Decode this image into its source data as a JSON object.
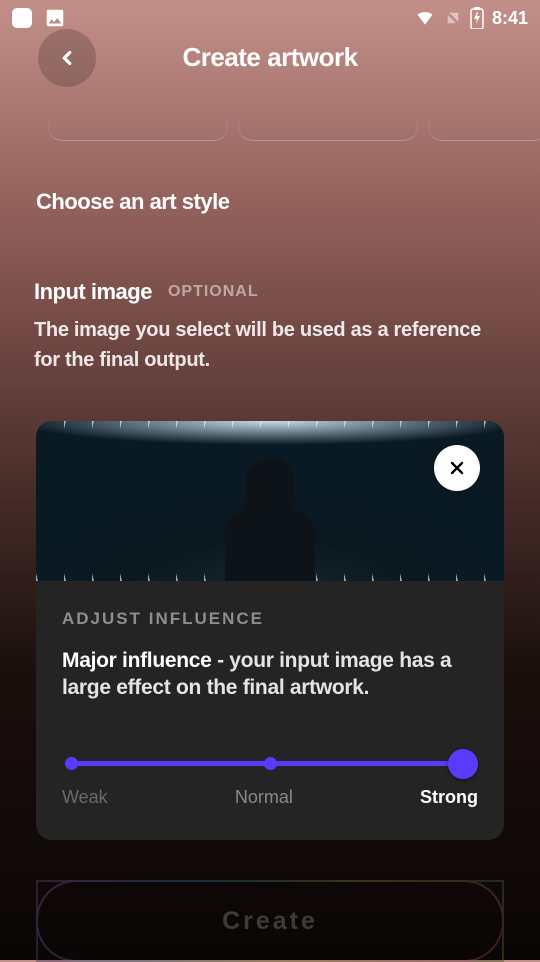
{
  "status_bar": {
    "time": "8:41"
  },
  "header": {
    "title": "Create artwork"
  },
  "art_style": {
    "section_title": "Choose an art style"
  },
  "input_image": {
    "label": "Input image",
    "optional_tag": "OPTIONAL",
    "description": "The image you select will be used as a reference for the final output."
  },
  "influence_card": {
    "adjust_label": "ADJUST INFLUENCE",
    "level_name": "Major influence",
    "level_desc": " - your input image has a large effect on the final artwork.",
    "slider": {
      "value": 2,
      "labels": [
        "Weak",
        "Normal",
        "Strong"
      ]
    }
  },
  "primary_action": {
    "label": "Create"
  },
  "colors": {
    "accent": "#5c39ff"
  }
}
